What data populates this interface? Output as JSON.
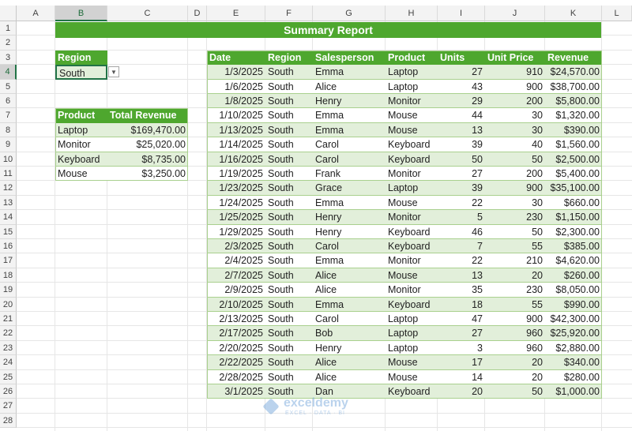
{
  "columns": [
    "A",
    "B",
    "C",
    "D",
    "E",
    "F",
    "G",
    "H",
    "I",
    "J",
    "K",
    "L"
  ],
  "rows": [
    "1",
    "2",
    "3",
    "4",
    "5",
    "6",
    "7",
    "8",
    "9",
    "10",
    "11",
    "12",
    "13",
    "14",
    "15",
    "16",
    "17",
    "18",
    "19",
    "20",
    "21",
    "22",
    "23",
    "24",
    "25",
    "26",
    "27",
    "28"
  ],
  "selected_cell": "B4",
  "title": "Summary Report",
  "region": {
    "label": "Region",
    "value": "South"
  },
  "summary": {
    "headers": [
      "Product",
      "Total Revenue"
    ],
    "rows": [
      [
        "Laptop",
        "$169,470.00"
      ],
      [
        "Monitor",
        "$25,020.00"
      ],
      [
        "Keyboard",
        "$8,735.00"
      ],
      [
        "Mouse",
        "$3,250.00"
      ]
    ]
  },
  "data_table": {
    "headers": [
      "Date",
      "Region",
      "Salesperson",
      "Product",
      "Units",
      "Unit Price",
      "Revenue"
    ],
    "rows": [
      [
        "1/3/2025",
        "South",
        "Emma",
        "Laptop",
        "27",
        "910",
        "$24,570.00"
      ],
      [
        "1/6/2025",
        "South",
        "Alice",
        "Laptop",
        "43",
        "900",
        "$38,700.00"
      ],
      [
        "1/8/2025",
        "South",
        "Henry",
        "Monitor",
        "29",
        "200",
        "$5,800.00"
      ],
      [
        "1/10/2025",
        "South",
        "Emma",
        "Mouse",
        "44",
        "30",
        "$1,320.00"
      ],
      [
        "1/13/2025",
        "South",
        "Emma",
        "Mouse",
        "13",
        "30",
        "$390.00"
      ],
      [
        "1/14/2025",
        "South",
        "Carol",
        "Keyboard",
        "39",
        "40",
        "$1,560.00"
      ],
      [
        "1/16/2025",
        "South",
        "Carol",
        "Keyboard",
        "50",
        "50",
        "$2,500.00"
      ],
      [
        "1/19/2025",
        "South",
        "Frank",
        "Monitor",
        "27",
        "200",
        "$5,400.00"
      ],
      [
        "1/23/2025",
        "South",
        "Grace",
        "Laptop",
        "39",
        "900",
        "$35,100.00"
      ],
      [
        "1/24/2025",
        "South",
        "Emma",
        "Mouse",
        "22",
        "30",
        "$660.00"
      ],
      [
        "1/25/2025",
        "South",
        "Henry",
        "Monitor",
        "5",
        "230",
        "$1,150.00"
      ],
      [
        "1/29/2025",
        "South",
        "Henry",
        "Keyboard",
        "46",
        "50",
        "$2,300.00"
      ],
      [
        "2/3/2025",
        "South",
        "Carol",
        "Keyboard",
        "7",
        "55",
        "$385.00"
      ],
      [
        "2/4/2025",
        "South",
        "Emma",
        "Monitor",
        "22",
        "210",
        "$4,620.00"
      ],
      [
        "2/7/2025",
        "South",
        "Alice",
        "Mouse",
        "13",
        "20",
        "$260.00"
      ],
      [
        "2/9/2025",
        "South",
        "Alice",
        "Monitor",
        "35",
        "230",
        "$8,050.00"
      ],
      [
        "2/10/2025",
        "South",
        "Emma",
        "Keyboard",
        "18",
        "55",
        "$990.00"
      ],
      [
        "2/13/2025",
        "South",
        "Carol",
        "Laptop",
        "47",
        "900",
        "$42,300.00"
      ],
      [
        "2/17/2025",
        "South",
        "Bob",
        "Laptop",
        "27",
        "960",
        "$25,920.00"
      ],
      [
        "2/20/2025",
        "South",
        "Henry",
        "Laptop",
        "3",
        "960",
        "$2,880.00"
      ],
      [
        "2/22/2025",
        "South",
        "Alice",
        "Mouse",
        "17",
        "20",
        "$340.00"
      ],
      [
        "2/28/2025",
        "South",
        "Alice",
        "Mouse",
        "14",
        "20",
        "$280.00"
      ],
      [
        "3/1/2025",
        "South",
        "Dan",
        "Keyboard",
        "20",
        "50",
        "$1,000.00"
      ]
    ]
  },
  "watermark": {
    "brand": "exceldemy",
    "tagline": "EXCEL · DATA · BI"
  },
  "colors": {
    "header_green": "#4ea72e",
    "band_green": "#e2efda",
    "border_green": "#a9d08e",
    "selection": "#217346"
  }
}
